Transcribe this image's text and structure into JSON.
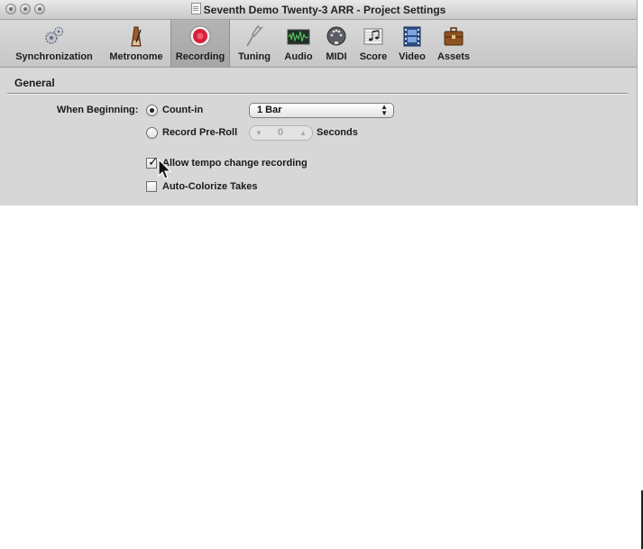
{
  "window": {
    "title": "Seventh Demo Twenty-3 ARR - Project Settings"
  },
  "toolbar": {
    "items": [
      {
        "label": "Synchronization",
        "icon": "gears-icon"
      },
      {
        "label": "Metronome",
        "icon": "metronome-icon"
      },
      {
        "label": "Recording",
        "icon": "record-icon",
        "selected": true
      },
      {
        "label": "Tuning",
        "icon": "tuning-fork-icon"
      },
      {
        "label": "Audio",
        "icon": "audio-waveform-icon"
      },
      {
        "label": "MIDI",
        "icon": "midi-connector-icon"
      },
      {
        "label": "Score",
        "icon": "score-notes-icon"
      },
      {
        "label": "Video",
        "icon": "film-icon"
      },
      {
        "label": "Assets",
        "icon": "briefcase-icon"
      }
    ]
  },
  "general": {
    "section_title": "General",
    "when_beginning_label": "When Beginning:",
    "count_in_label": "Count-in",
    "count_in_selected": true,
    "count_in_value": "1 Bar",
    "record_preroll_label": "Record Pre-Roll",
    "preroll_value": "0",
    "preroll_unit": "Seconds",
    "allow_tempo_label": "Allow tempo change recording",
    "allow_tempo_checked": true,
    "auto_colorize_label": "Auto-Colorize Takes",
    "auto_colorize_checked": false
  },
  "colors": {
    "record_red": "#d8203a",
    "window_bg": "#d7d7d7"
  }
}
